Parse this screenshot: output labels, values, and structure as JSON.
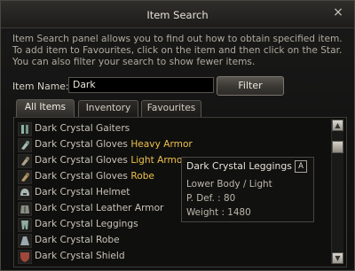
{
  "window": {
    "title": "Item Search",
    "close_icon": "×"
  },
  "description": [
    "Item Search panel allows you to find out how to obtain specified item.",
    "To add item to Favourites, click on the item and then click on the Star.",
    "You can also filter your search to show fewer items."
  ],
  "search": {
    "label": "Item Name:",
    "value": "Dark",
    "filter_label": "Filter"
  },
  "tabs": [
    {
      "label": "All Items",
      "active": true
    },
    {
      "label": "Inventory",
      "active": false
    },
    {
      "label": "Favourites",
      "active": false
    }
  ],
  "items": [
    {
      "name": "Dark Crystal Gaiters",
      "suffix": "",
      "icon": "gaiters-icon"
    },
    {
      "name": "Dark Crystal Gloves",
      "suffix": "Heavy Armor",
      "icon": "gloves-icon"
    },
    {
      "name": "Dark Crystal Gloves",
      "suffix": "Light Armor",
      "icon": "gloves-icon"
    },
    {
      "name": "Dark Crystal Gloves",
      "suffix": "Robe",
      "icon": "gloves-icon"
    },
    {
      "name": "Dark Crystal Helmet",
      "suffix": "",
      "icon": "helmet-icon"
    },
    {
      "name": "Dark Crystal Leather Armor",
      "suffix": "",
      "icon": "leather-armor-icon"
    },
    {
      "name": "Dark Crystal Leggings",
      "suffix": "",
      "icon": "leggings-icon"
    },
    {
      "name": "Dark Crystal Robe",
      "suffix": "",
      "icon": "robe-icon"
    },
    {
      "name": "Dark Crystal Shield",
      "suffix": "",
      "icon": "shield-icon"
    }
  ],
  "tooltip": {
    "name": "Dark Crystal Leggings",
    "grade": "A",
    "type": "Lower Body / Light",
    "pdef": "P. Def. : 80",
    "weight": "Weight : 1480"
  },
  "colors": {
    "highlight": "#f0c24a",
    "item_text": "#c9c4b7"
  }
}
